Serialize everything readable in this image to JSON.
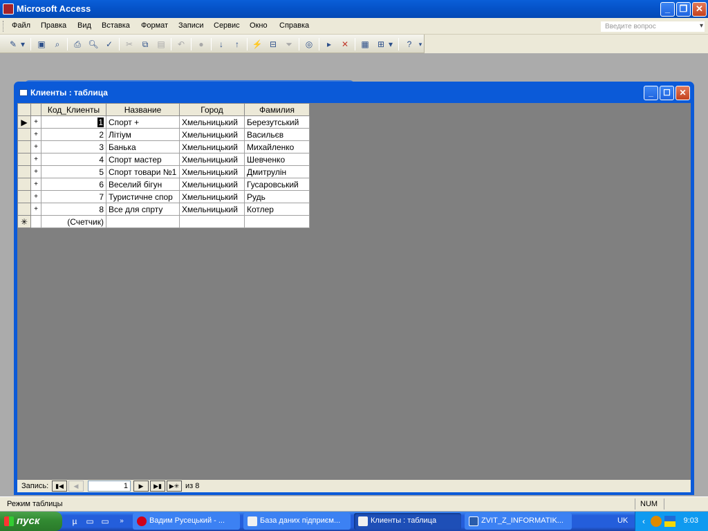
{
  "app": {
    "title": "Microsoft Access"
  },
  "menu": [
    "Файл",
    "Правка",
    "Вид",
    "Вставка",
    "Формат",
    "Записи",
    "Сервис",
    "Окно",
    "Справка"
  ],
  "askbox": {
    "placeholder": "Введите вопрос"
  },
  "child_window": {
    "title": "Клиенты : таблица"
  },
  "table": {
    "columns": [
      "Код_Клиенты",
      "Название",
      "Город",
      "Фамилия"
    ],
    "rows": [
      {
        "id": "1",
        "name": "Спорт +",
        "city": "Хмельницький",
        "surname": "Березутський"
      },
      {
        "id": "2",
        "name": "Літіум",
        "city": "Хмельницький",
        "surname": "Васильєв"
      },
      {
        "id": "3",
        "name": "Банька",
        "city": "Хмельницький",
        "surname": "Михайленко"
      },
      {
        "id": "4",
        "name": "Спорт мастер",
        "city": "Хмельницький",
        "surname": "Шевченко"
      },
      {
        "id": "5",
        "name": "Спорт товари №1",
        "city": "Хмельницький",
        "surname": "Дмитрулін"
      },
      {
        "id": "6",
        "name": "Веселий бігун",
        "city": "Хмельницький",
        "surname": "Гусаровський"
      },
      {
        "id": "7",
        "name": "Туристичне спор",
        "city": "Хмельницький",
        "surname": "Рудь"
      },
      {
        "id": "8",
        "name": "Все для спрту",
        "city": "Хмельницький",
        "surname": "Котлер"
      }
    ],
    "new_row_placeholder": "(Счетчик)"
  },
  "record_nav": {
    "label": "Запись:",
    "current": "1",
    "of_label": "из",
    "total": "8"
  },
  "status": {
    "mode": "Режим таблицы",
    "num": "NUM"
  },
  "taskbar": {
    "start_label": "пуск",
    "tasks": [
      "Вадим Русецький - ...",
      "База даних підприєм...",
      "Клиенты : таблица",
      "ZVIT_Z_INFORMATIK..."
    ],
    "lang": "UK",
    "clock": "9:03"
  }
}
